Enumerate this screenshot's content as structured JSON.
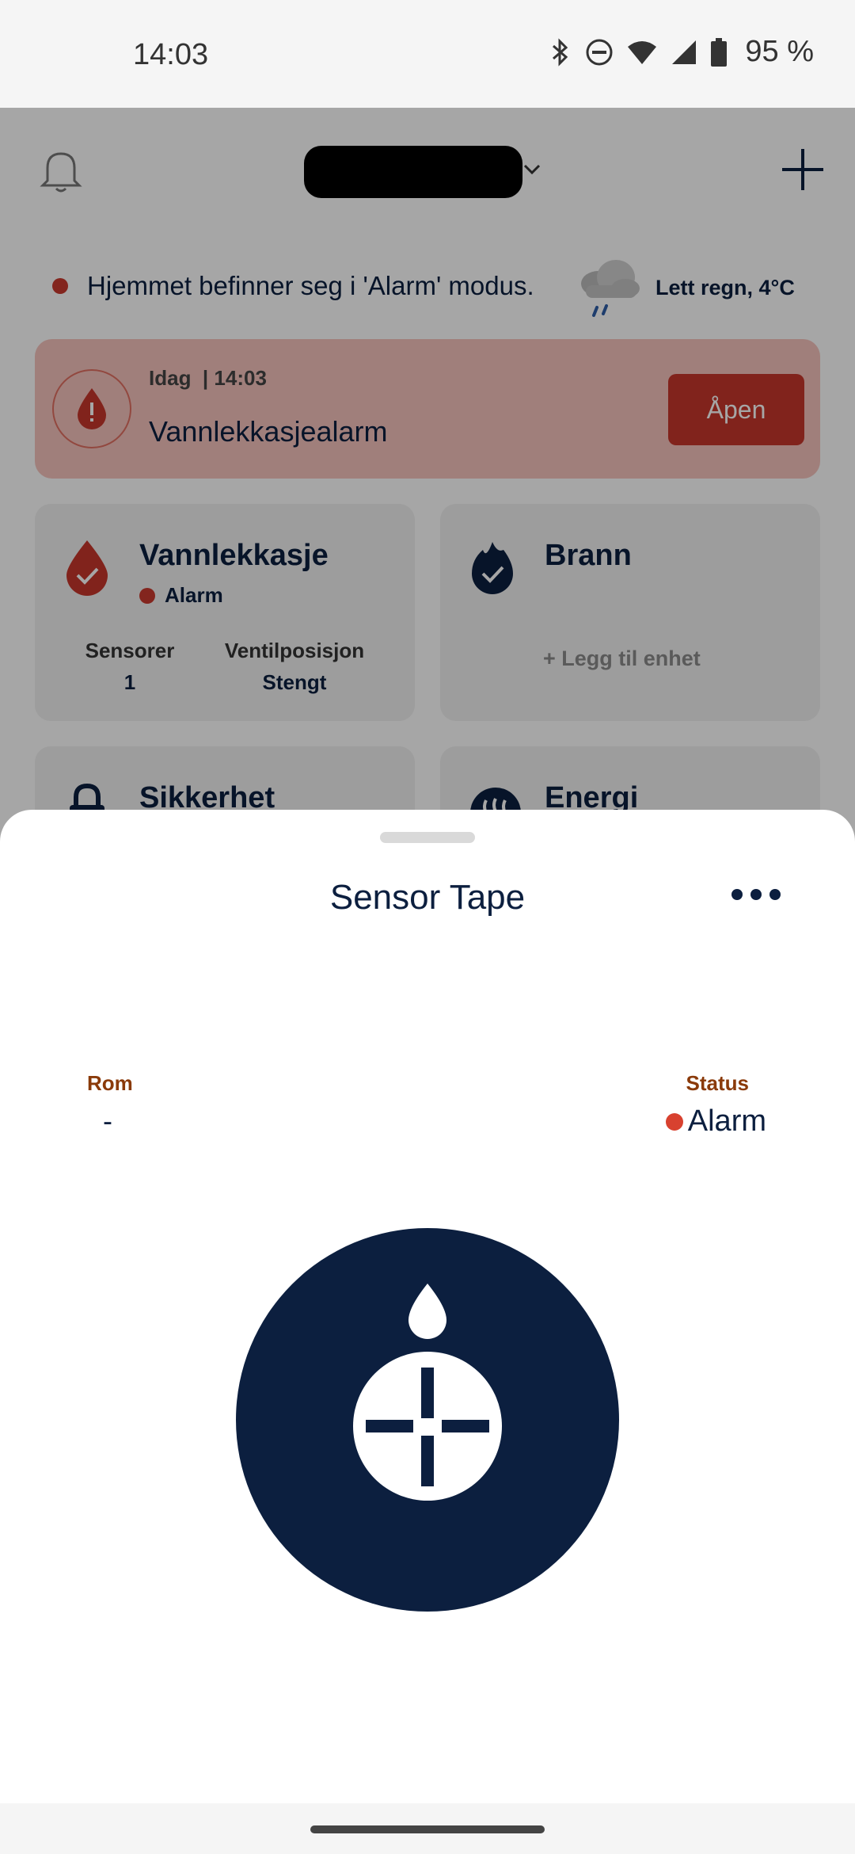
{
  "status_bar": {
    "time": "14:03",
    "battery": "95 %",
    "icons": [
      "bluetooth-icon",
      "dnd-icon",
      "wifi-icon",
      "cell-signal-icon",
      "battery-icon"
    ]
  },
  "header": {
    "icons": [
      "bell-icon",
      "chevron-down-icon",
      "plus-icon"
    ]
  },
  "mode": {
    "text": "Hjemmet befinner seg i 'Alarm' modus.",
    "weather": "Lett regn, 4°C"
  },
  "alert": {
    "date": "Idag",
    "time": "| 14:03",
    "title": "Vannlekkasjealarm",
    "button": "Åpen"
  },
  "tiles": [
    {
      "title": "Vannlekkasje",
      "status": "Alarm",
      "stats": [
        {
          "label": "Sensorer",
          "value": "1"
        },
        {
          "label": "Ventilposisjon",
          "value": "Stengt"
        }
      ]
    },
    {
      "title": "Brann",
      "action": "Legg til enhet"
    },
    {
      "title": "Sikkerhet"
    },
    {
      "title": "Energi"
    }
  ],
  "sheet": {
    "title": "Sensor Tape",
    "room_label": "Rom",
    "room_value": "-",
    "status_label": "Status",
    "status_value": "Alarm"
  },
  "colors": {
    "navy": "#0c1f3f",
    "alarm_red": "#c93a2e",
    "alert_bg": "#f6c3bd",
    "label_brown": "#8a3a0a"
  }
}
